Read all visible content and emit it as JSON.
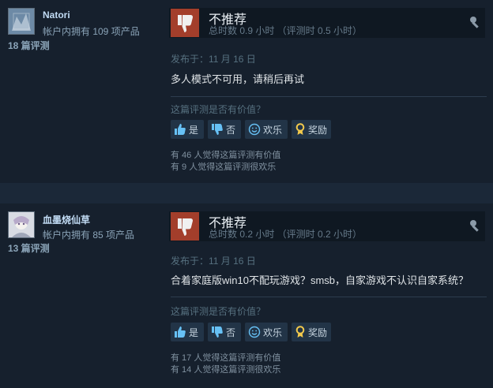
{
  "reviews": [
    {
      "author": "Natori",
      "owned": "帐户内拥有 109 项产品",
      "review_count": "18 篇评测",
      "verdict": "不推荐",
      "playtime": "总时数 0.9 小时 （评测时 0.5 小时）",
      "posted": "发布于：11 月 16 日",
      "text": "多人模式不可用，请稍后再试",
      "helpful_question": "这篇评测是否有价值？",
      "vote_yes": "是",
      "vote_no": "否",
      "vote_funny": "欢乐",
      "vote_award": "奖励",
      "helpful_count": "有 46 人觉得这篇评测有价值",
      "funny_count": "有 9 人觉得这篇评测很欢乐"
    },
    {
      "author": "血墨烧仙草",
      "owned": "帐户内拥有 85 项产品",
      "review_count": "13 篇评测",
      "verdict": "不推荐",
      "playtime": "总时数 0.2 小时 （评测时 0.2 小时）",
      "posted": "发布于：11 月 16 日",
      "text": "合着家庭版win10不配玩游戏？smsb，自家游戏不认识自家系统？",
      "helpful_question": "这篇评测是否有价值？",
      "vote_yes": "是",
      "vote_no": "否",
      "vote_funny": "欢乐",
      "vote_award": "奖励",
      "helpful_count": "有 17 人觉得这篇评测有价值",
      "funny_count": "有 14 人觉得这篇评测很欢乐"
    }
  ],
  "colors": {
    "thumb_down_bg": "#a33e2b",
    "accent": "#67c1f5",
    "author": "#c1dbf4"
  },
  "icons": [
    "thumbs-down-icon",
    "thumbs-up-icon",
    "smiley-icon",
    "award-icon",
    "info-icon"
  ]
}
